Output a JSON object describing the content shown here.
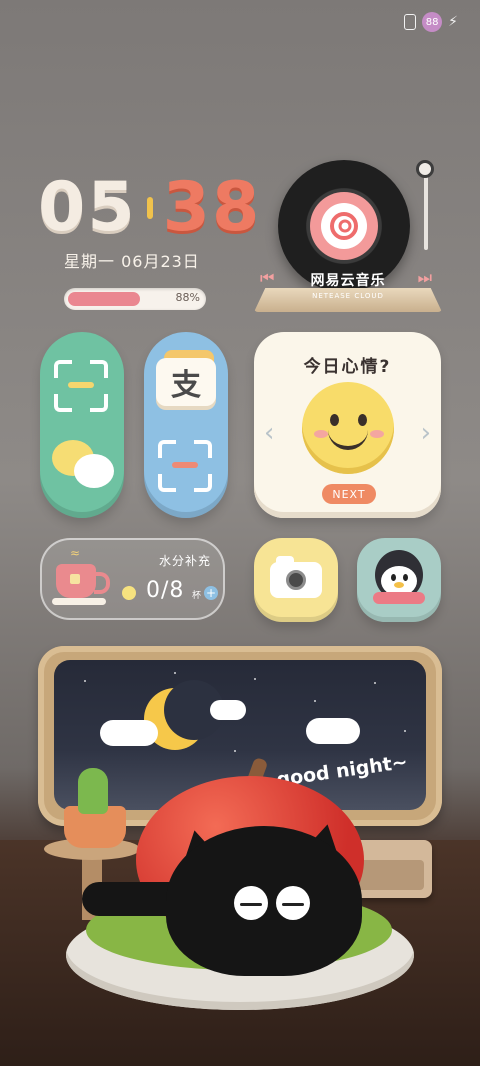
{
  "status_bar": {
    "battery_level": "88",
    "battery_color": "#c58cc6",
    "icons": [
      "sim-icon",
      "battery-icon",
      "charging-bolt-icon"
    ]
  },
  "clock": {
    "hours": "05",
    "minutes": "38"
  },
  "date": {
    "text": "星期一  06月23日"
  },
  "progress": {
    "percent_label": "88%",
    "value": 0.88
  },
  "music": {
    "title": "网易云音乐",
    "subtitle": "NETEASE CLOUD"
  },
  "apps": {
    "wechat": {
      "icon": "wechat-icon"
    },
    "alipay": {
      "glyph": "支",
      "icon": "alipay-icon"
    },
    "camera": {
      "icon": "camera-icon"
    },
    "qq": {
      "icon": "qq-penguin-icon"
    }
  },
  "mood": {
    "title": "今日心情?",
    "next_label": "NEXT"
  },
  "water": {
    "title": "水分补充",
    "count": "0/8",
    "unit": "杯",
    "plus": "+"
  },
  "scene": {
    "caption": "good night~"
  },
  "colors": {
    "clock_hours": "#f4ece2",
    "clock_minutes": "#ee7a62",
    "wechat_bg": "#6fc2a2",
    "alipay_bg": "#8ec0e3",
    "camera_bg": "#f7e495",
    "qq_bg": "#a9cdc6",
    "next_btn": "#ef8a63"
  }
}
